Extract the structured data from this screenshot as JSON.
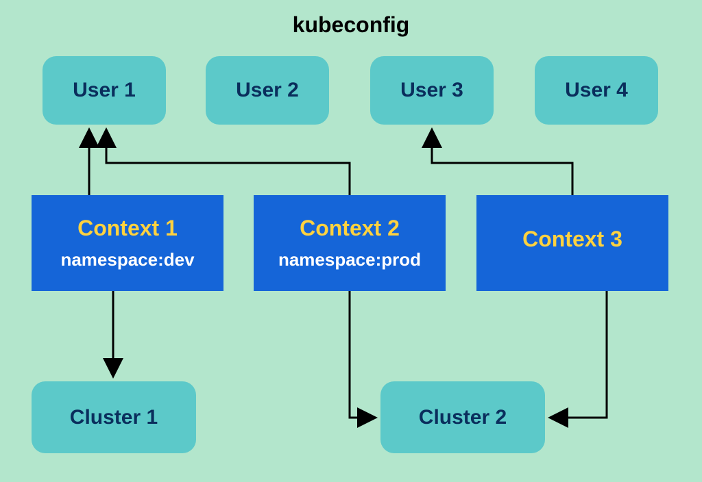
{
  "title": "kubeconfig",
  "users": [
    {
      "label": "User 1"
    },
    {
      "label": "User 2"
    },
    {
      "label": "User 3"
    },
    {
      "label": "User 4"
    }
  ],
  "contexts": [
    {
      "label": "Context 1",
      "namespace": "namespace:dev"
    },
    {
      "label": "Context 2",
      "namespace": "namespace:prod"
    },
    {
      "label": "Context 3",
      "namespace": ""
    }
  ],
  "clusters": [
    {
      "label": "Cluster 1"
    },
    {
      "label": "Cluster 2"
    }
  ],
  "relationships": [
    {
      "from": "context-1",
      "to": "user-1"
    },
    {
      "from": "context-2",
      "to": "user-1"
    },
    {
      "from": "context-3",
      "to": "user-3"
    },
    {
      "from": "context-1",
      "to": "cluster-1"
    },
    {
      "from": "context-2",
      "to": "cluster-2"
    },
    {
      "from": "context-3",
      "to": "cluster-2"
    }
  ]
}
